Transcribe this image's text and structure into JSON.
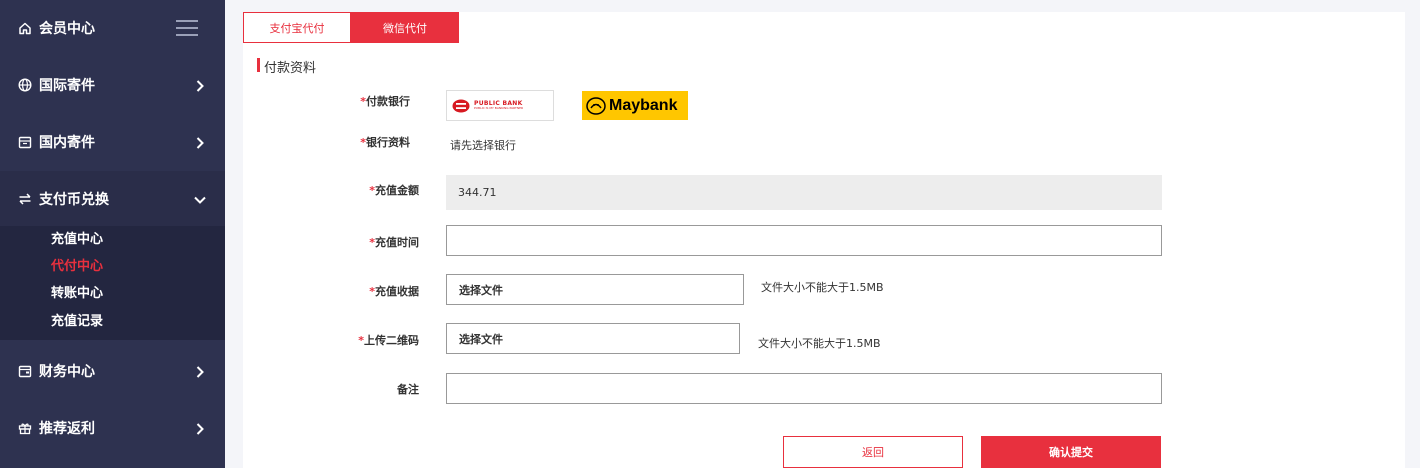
{
  "sidebar": {
    "items": [
      {
        "label": "会员中心",
        "icon": "home-icon"
      },
      {
        "label": "国际寄件",
        "icon": "globe-icon"
      },
      {
        "label": "国内寄件",
        "icon": "box-icon"
      },
      {
        "label": "支付币兑换",
        "icon": "exchange-icon"
      },
      {
        "label": "财务中心",
        "icon": "wallet-icon"
      },
      {
        "label": "推荐返利",
        "icon": "gift-icon"
      }
    ],
    "submenu": [
      "充值中心",
      "代付中心",
      "转账中心",
      "充值记录"
    ],
    "active_submenu": "代付中心",
    "accent_color": "#e8303e",
    "bg_color": "#2e3250"
  },
  "tabs": [
    "支付宝代付",
    "微信代付"
  ],
  "active_tab": "微信代付",
  "section_title": "付款资料",
  "form": {
    "bank_label": "付款银行",
    "banks": {
      "public_name": "PUBLIC BANK",
      "public_sub": "PUBLIC IS MY BANKING PARTNER",
      "maybank_name": "Maybank"
    },
    "bank_info_label": "银行资料",
    "bank_info_text": "请先选择银行",
    "amount_label": "充值金额",
    "amount_value": "344.71",
    "time_label": "充值时间",
    "time_value": "",
    "receipt_label": "充值收据",
    "receipt_button": "选择文件",
    "receipt_hint": "文件大小不能大于1.5MB",
    "qr_label": "上传二维码",
    "qr_button": "选择文件",
    "qr_hint": "文件大小不能大于1.5MB",
    "remark_label": "备注",
    "remark_value": "",
    "required_mark": "*"
  },
  "buttons": {
    "back": "返回",
    "submit": "确认提交"
  }
}
